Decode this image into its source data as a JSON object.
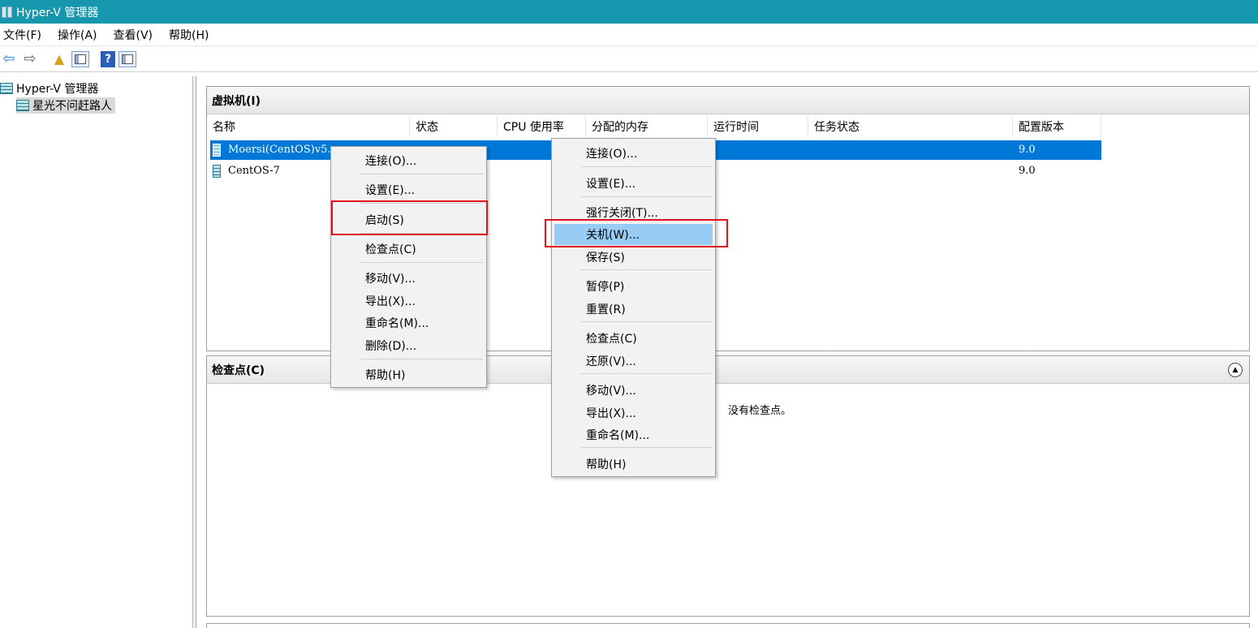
{
  "window": {
    "title": "Hyper-V 管理器"
  },
  "menubar": [
    "文件(F)",
    "操作(A)",
    "查看(V)",
    "帮助(H)"
  ],
  "toolbar": [
    {
      "name": "back",
      "icon": "back-arrow-icon",
      "glyph": "⇦"
    },
    {
      "name": "forward",
      "icon": "forward-arrow-icon",
      "glyph": "⇨"
    },
    {
      "name": "up",
      "icon": "up-folder-icon",
      "glyph": "▲"
    },
    {
      "name": "show-tree",
      "icon": "show-hide-tree-icon"
    },
    {
      "name": "help",
      "icon": "help-icon",
      "glyph": "?"
    },
    {
      "name": "show-actions",
      "icon": "show-hide-action-pane-icon"
    }
  ],
  "tree": {
    "root": "Hyper-V 管理器",
    "server": "星光不问赶路人"
  },
  "vm_panel": {
    "title": "虚拟机(I)",
    "columns": [
      "名称",
      "状态",
      "CPU 使用率",
      "分配的内存",
      "运行时间",
      "任务状态",
      "配置版本"
    ],
    "rows": [
      {
        "name": "Moersi(CentOS)v5.",
        "version": "9.0",
        "selected": true
      },
      {
        "name": "CentOS-7",
        "version": "9.0",
        "selected": false
      }
    ]
  },
  "checkpoint_panel": {
    "title": "检查点(C)",
    "empty_text": "没有检查点。"
  },
  "context_menu_off": {
    "items": [
      "连接(O)...",
      "设置(E)...",
      "启动(S)",
      "检查点(C)",
      "移动(V)...",
      "导出(X)...",
      "重命名(M)...",
      "删除(D)...",
      "帮助(H)"
    ]
  },
  "context_menu_running": {
    "items": [
      "连接(O)...",
      "设置(E)...",
      "强行关闭(T)...",
      "关机(W)...",
      "保存(S)",
      "暂停(P)",
      "重置(R)",
      "检查点(C)",
      "还原(V)...",
      "移动(V)...",
      "导出(X)...",
      "重命名(M)...",
      "帮助(H)"
    ],
    "hovered": "关机(W)..."
  },
  "colors": {
    "titlebar": "#1797ae",
    "selection": "#0078d7",
    "hover": "#99ccf4",
    "highlight_box": "#e0141c"
  }
}
